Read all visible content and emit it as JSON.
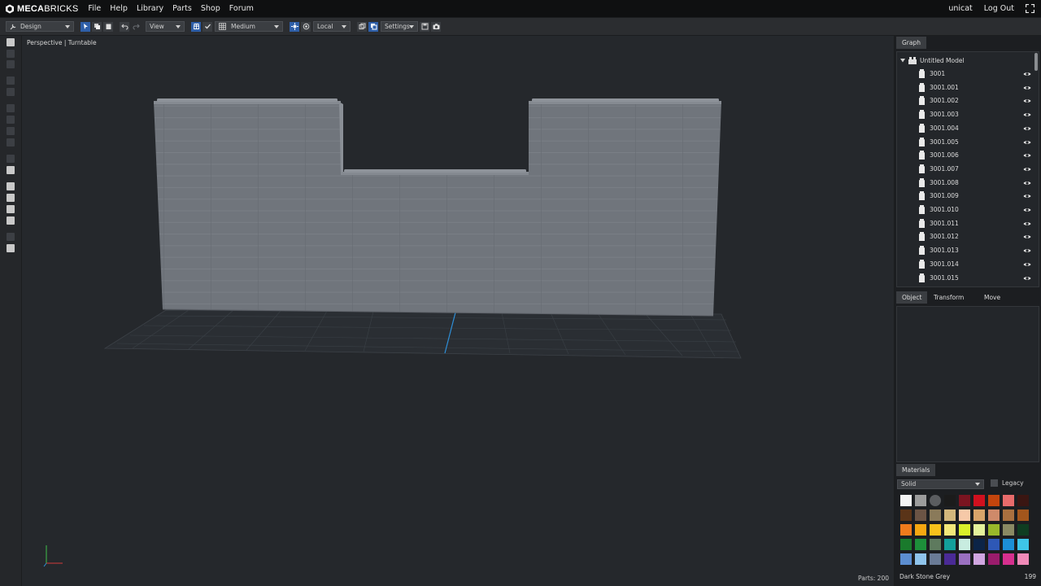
{
  "app": {
    "brand_bold": "MECA",
    "brand_rest": "BRICKS"
  },
  "menu": [
    "File",
    "Help",
    "Library",
    "Parts",
    "Shop",
    "Forum"
  ],
  "user": {
    "name": "unicat",
    "logout": "Log Out"
  },
  "toolbar": {
    "mode": "Design",
    "view": "View",
    "quality": "Medium",
    "space": "Local",
    "settings": "Settings"
  },
  "viewport": {
    "label": "Perspective | Turntable",
    "parts": "Parts: 200"
  },
  "graph": {
    "tab": "Graph",
    "root": "Untitled Model",
    "items": [
      "3001",
      "3001.001",
      "3001.002",
      "3001.003",
      "3001.004",
      "3001.005",
      "3001.006",
      "3001.007",
      "3001.008",
      "3001.009",
      "3001.010",
      "3001.011",
      "3001.012",
      "3001.013",
      "3001.014",
      "3001.015"
    ]
  },
  "object_tabs": [
    "Object",
    "Transform",
    "Move"
  ],
  "materials": {
    "tab": "Materials",
    "type": "Solid",
    "legacy": "Legacy",
    "selected_name": "Dark Stone Grey",
    "selected_id": "199",
    "swatches": [
      "#f4f4f4",
      "#9c9c9c",
      "#5b5d60",
      "#1b1b1b",
      "#7a1420",
      "#d0101e",
      "#c4450d",
      "#e86b6b",
      "#3a1612",
      "#5a3418",
      "#6b5445",
      "#8a7a5a",
      "#d3b77c",
      "#f6c9a8",
      "#d9a46a",
      "#cf8a6a",
      "#a9703f",
      "#a3561c",
      "#ef7b1c",
      "#f5a711",
      "#f7c21b",
      "#f3e87a",
      "#d9ef2a",
      "#e4f29c",
      "#9ab82a",
      "#8a8a64",
      "#0f3d21",
      "#1a7a2c",
      "#1d8f3a",
      "#5e7a5e",
      "#139f9b",
      "#c8ece0",
      "#0c2447",
      "#2e58b6",
      "#1c8fd6",
      "#3ec5e8",
      "#5c8ed0",
      "#8fc4ec",
      "#6a7b96",
      "#4a2a96",
      "#9a70c0",
      "#d0a6e0",
      "#9a1c6c",
      "#d62f8e",
      "#f08ab8"
    ]
  }
}
